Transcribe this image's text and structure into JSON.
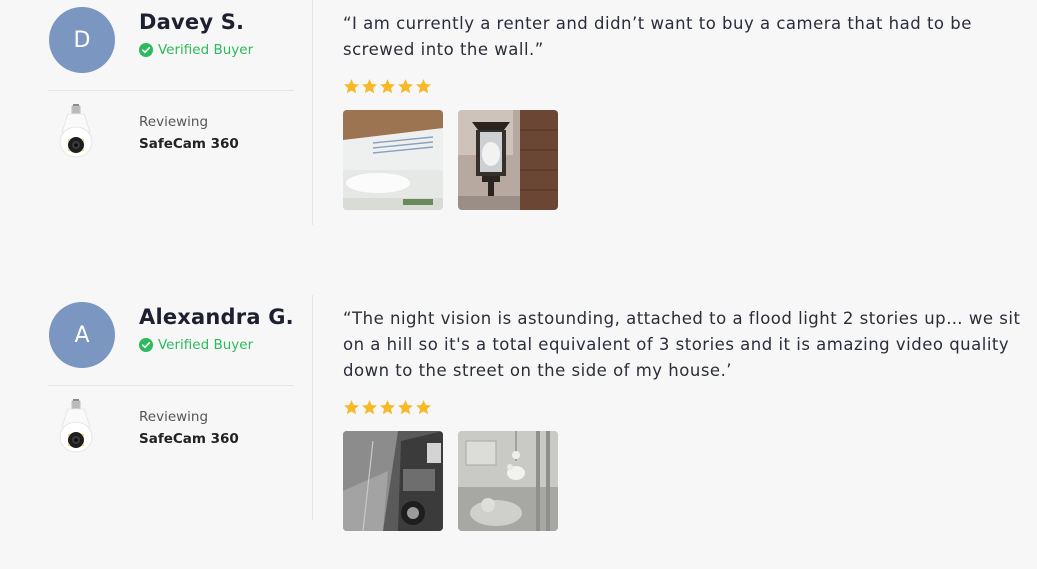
{
  "reviews": [
    {
      "initial": "D",
      "name": "Davey S.",
      "verified_label": "Verified Buyer",
      "reviewing_label": "Reviewing",
      "product": "SafeCam 360",
      "quote": "“I am currently a renter and didn’t want to buy a camera that had to be screwed into the wall.”",
      "rating": 5,
      "photos": [
        "product-box-photo",
        "porch-light-camera-photo"
      ]
    },
    {
      "initial": "A",
      "name": "Alexandra G.",
      "verified_label": "Verified Buyer",
      "reviewing_label": "Reviewing",
      "product": "SafeCam 360",
      "quote": "“The night vision is astounding, attached to a flood light 2 stories up… we sit on a hill so it's a total equivalent of 3 stories and it is amazing video quality down to the street on the side of my house.’",
      "rating": 5,
      "photos": [
        "night-driveway-photo",
        "night-nursery-photo"
      ]
    }
  ],
  "colors": {
    "avatar": "#7b96c0",
    "verified": "#2bbb5c",
    "star": "#f7b928",
    "background": "#f7f7f7"
  }
}
